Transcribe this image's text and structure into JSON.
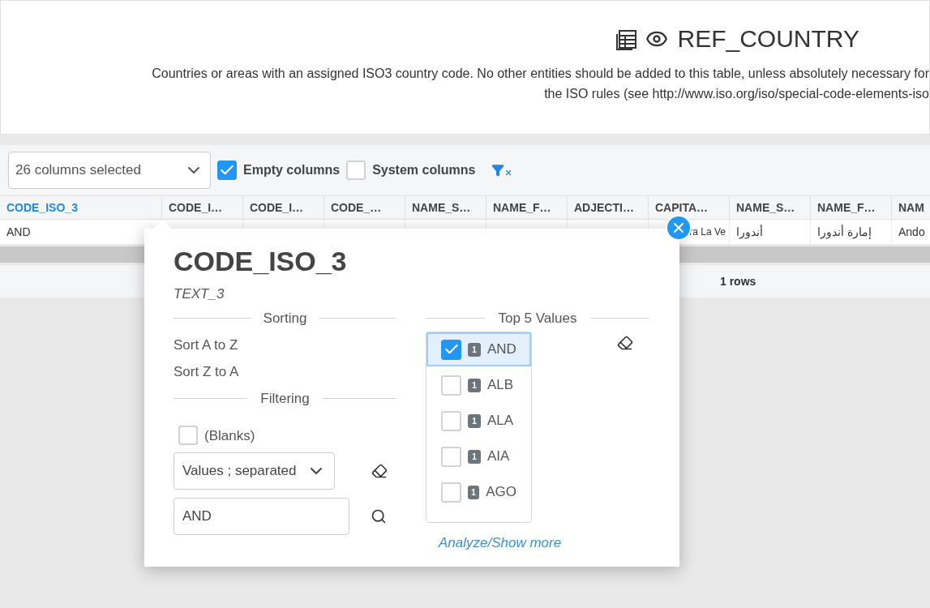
{
  "header": {
    "title": "REF_COUNTRY",
    "description": [
      "Countries or areas with an assigned ISO3 country code. No other entities should be added to this table, unless absolutely necessary for",
      "the ISO rules (see http://www.iso.org/iso/special-code-elements-iso"
    ]
  },
  "toolbar": {
    "columns_select": "26 columns selected",
    "empty_columns": {
      "label": "Empty columns",
      "checked": true
    },
    "system_columns": {
      "label": "System columns",
      "checked": false
    }
  },
  "table": {
    "columns": [
      {
        "label": "CODE_ISO_3",
        "selected": true
      },
      {
        "label": "CODE_I…",
        "selected": false
      },
      {
        "label": "CODE_I…",
        "selected": false
      },
      {
        "label": "CODE_…",
        "selected": false
      },
      {
        "label": "NAME_S…",
        "selected": false
      },
      {
        "label": "NAME_F…",
        "selected": false
      },
      {
        "label": "ADJECTI…",
        "selected": false
      },
      {
        "label": "CAPITA…",
        "selected": false
      },
      {
        "label": "NAME_S…",
        "selected": false
      },
      {
        "label": "NAME_F…",
        "selected": false
      },
      {
        "label": "NAM",
        "selected": false
      }
    ],
    "rows": [
      [
        "AND",
        null,
        null,
        null,
        null,
        null,
        null,
        "ra La Ve",
        "أندورا",
        "إمارة أندورا",
        "Ando"
      ]
    ],
    "footer": "1 rows"
  },
  "popup": {
    "title": "CODE_ISO_3",
    "type": "TEXT_3",
    "sorting_heading": "Sorting",
    "sort_options": [
      "Sort A to Z",
      "Sort Z to A"
    ],
    "filtering_heading": "Filtering",
    "blanks": {
      "label": "(Blanks)",
      "checked": false
    },
    "filter_mode": "Values ; separated",
    "filter_value": "AND",
    "top_heading": "Top 5 Values",
    "top_values": [
      {
        "value": "AND",
        "count": "1",
        "checked": true
      },
      {
        "value": "ALB",
        "count": "1",
        "checked": false
      },
      {
        "value": "ALA",
        "count": "1",
        "checked": false
      },
      {
        "value": "AIA",
        "count": "1",
        "checked": false
      },
      {
        "value": "AGO",
        "count": "1",
        "checked": false
      }
    ],
    "more_link": "Analyze/Show more"
  }
}
